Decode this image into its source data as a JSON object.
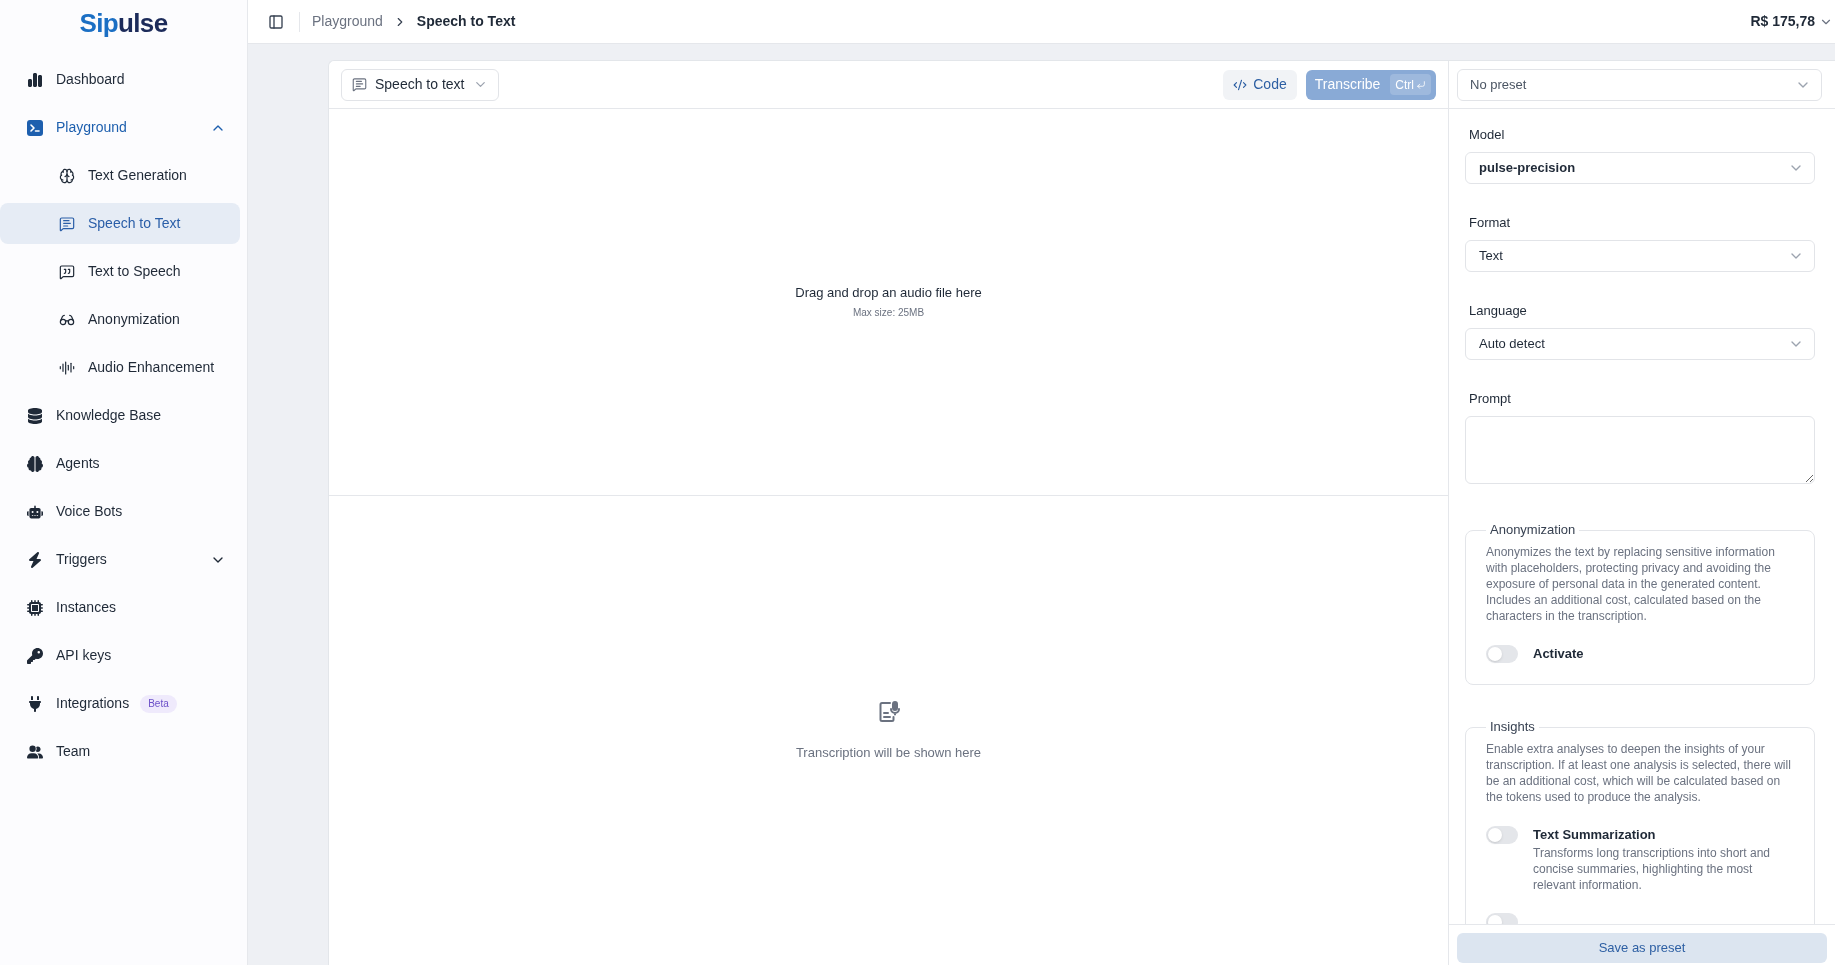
{
  "logo": {
    "text": "Sipulse"
  },
  "sidebar": {
    "items": [
      {
        "label": "Dashboard",
        "selected": false
      },
      {
        "label": "Playground",
        "selected": false,
        "expanded": true,
        "children": [
          {
            "label": "Text Generation",
            "selected": false
          },
          {
            "label": "Speech to Text",
            "selected": true
          },
          {
            "label": "Text to Speech",
            "selected": false
          },
          {
            "label": "Anonymization",
            "selected": false
          },
          {
            "label": "Audio Enhancement",
            "selected": false
          }
        ]
      },
      {
        "label": "Knowledge Base",
        "selected": false
      },
      {
        "label": "Agents",
        "selected": false
      },
      {
        "label": "Voice Bots",
        "selected": false
      },
      {
        "label": "Triggers",
        "selected": false,
        "expanded": false
      },
      {
        "label": "Instances",
        "selected": false
      },
      {
        "label": "API keys",
        "selected": false
      },
      {
        "label": "Integrations",
        "selected": false,
        "badge": "Beta"
      },
      {
        "label": "Team",
        "selected": false
      }
    ]
  },
  "topbar": {
    "breadcrumb": [
      {
        "label": "Playground",
        "current": false
      },
      {
        "label": "Speech to Text",
        "current": true
      }
    ],
    "balance": "R$ 175,78"
  },
  "editor": {
    "mode_select": {
      "value": "Speech to text"
    },
    "code_button": {
      "label": "Code"
    },
    "transcribe_button": {
      "label": "Transcribe",
      "shortcut": "Ctrl",
      "disabled": true
    },
    "dropzone": {
      "title": "Drag and drop an audio file here",
      "hint": "Max size: 25MB"
    },
    "output": {
      "empty_message": "Transcription will be shown here"
    }
  },
  "settings": {
    "preset_select": {
      "value": "No preset"
    },
    "fields": [
      {
        "kind": "select",
        "label": "Model",
        "value": "pulse-precision",
        "strong": true
      },
      {
        "kind": "select",
        "label": "Format",
        "value": "Text",
        "strong": false
      },
      {
        "kind": "select",
        "label": "Language",
        "value": "Auto detect",
        "strong": false
      },
      {
        "kind": "textarea",
        "label": "Prompt"
      }
    ],
    "sections": [
      {
        "legend": "Anonymization",
        "description": "Anonymizes the text by replacing sensitive information with placeholders, protecting privacy and avoiding the exposure of personal data in the generated content. Includes an additional cost, calculated based on the characters in the transcription.",
        "options": [
          {
            "label": "Activate",
            "on": false
          }
        ]
      },
      {
        "legend": "Insights",
        "description": "Enable extra analyses to deepen the insights of your transcription. If at least one analysis is selected, there will be an additional cost, which will be calculated based on the tokens used to produce the analysis.",
        "options": [
          {
            "label": "Text Summarization",
            "description": "Transforms long transcriptions into short and concise summaries, highlighting the most relevant information.",
            "on": false
          },
          {
            "on": false
          }
        ]
      }
    ],
    "save_button": {
      "label": "Save as preset"
    }
  }
}
